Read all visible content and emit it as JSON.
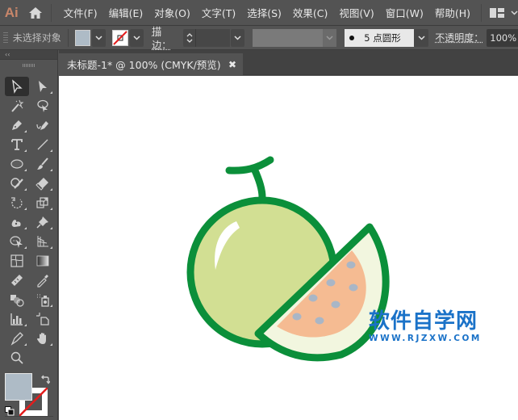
{
  "app": {
    "logo": "Ai"
  },
  "menu": {
    "items": [
      {
        "label": "文件(F)"
      },
      {
        "label": "编辑(E)"
      },
      {
        "label": "对象(O)"
      },
      {
        "label": "文字(T)"
      },
      {
        "label": "选择(S)"
      },
      {
        "label": "效果(C)"
      },
      {
        "label": "视图(V)"
      },
      {
        "label": "窗口(W)"
      },
      {
        "label": "帮助(H)"
      }
    ]
  },
  "control_bar": {
    "selection_status": "未选择对象",
    "fill_color": "#aebbc6",
    "stroke_label": "描边：",
    "stroke_value": "",
    "brush_label": "5 点圆形",
    "opacity_label": "不透明度：",
    "opacity_value": "100%"
  },
  "toolbox": {
    "collapse": "‹‹",
    "fill_color": "#aebbc6",
    "stroke_color": "none"
  },
  "document": {
    "tab_title": "未标题-1* @ 100% (CMYK/预览)",
    "close": "✖"
  },
  "artwork": {
    "subject": "melon illustration",
    "colors": {
      "outline": "#0b8f3a",
      "rind": "#d2df93",
      "highlight": "#ffffff",
      "slice_rind": "#f2f6df",
      "flesh": "#f5bb92",
      "seeds": "#a9b6c6"
    }
  },
  "watermark": {
    "title": "软件自学网",
    "url": "WWW.RJZXW.COM",
    "color": "#1a72c8"
  }
}
